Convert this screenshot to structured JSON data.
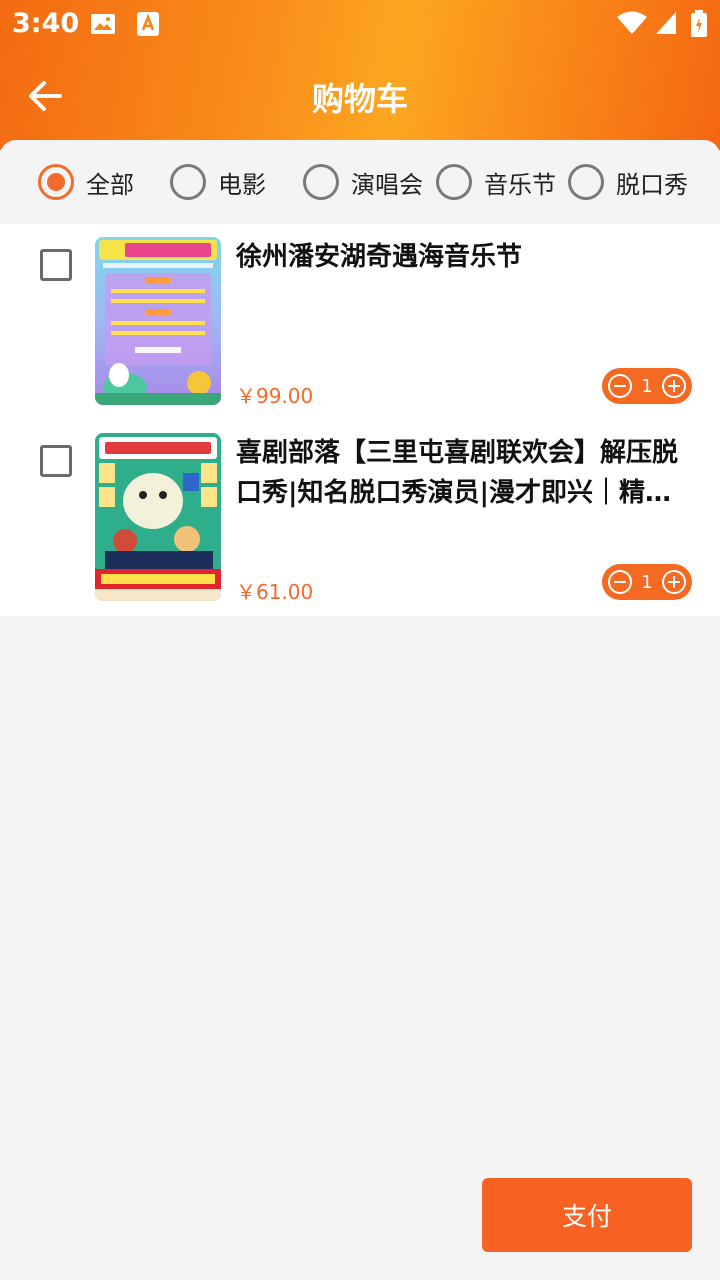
{
  "status_bar": {
    "time": "3:40"
  },
  "header": {
    "title": "购物车"
  },
  "filters": [
    {
      "label": "全部",
      "checked": true
    },
    {
      "label": "电影",
      "checked": false
    },
    {
      "label": "演唱会",
      "checked": false
    },
    {
      "label": "音乐节",
      "checked": false
    },
    {
      "label": "脱口秀",
      "checked": false
    }
  ],
  "items": [
    {
      "title": "徐州潘安湖奇遇海音乐节",
      "price": "￥99.00",
      "quantity": "1"
    },
    {
      "title": "喜剧部落【三里屯喜剧联欢会】解压脱口秀|知名脱口秀演员|漫才即兴｜精选喜剧演出",
      "price": "￥61.00",
      "quantity": "1"
    }
  ],
  "footer": {
    "pay_label": "支付"
  },
  "colors": {
    "accent": "#f26a2c",
    "header_orange": "#f98c1a"
  }
}
